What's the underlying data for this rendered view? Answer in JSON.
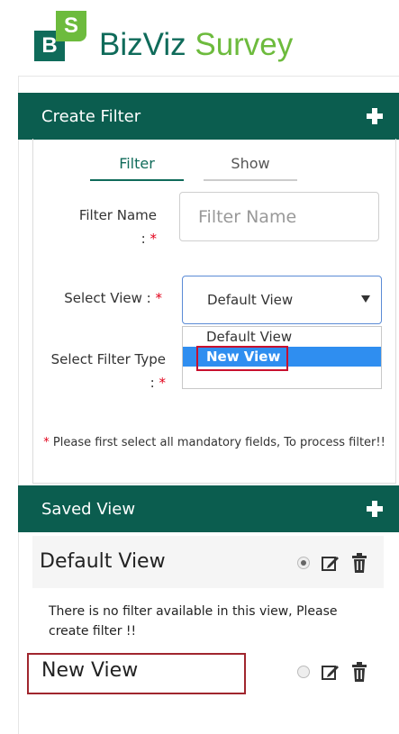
{
  "brand": {
    "logo_b": "B",
    "logo_s": "S",
    "word1": "BizViz",
    "word2": "Survey"
  },
  "create_filter": {
    "title": "Create Filter",
    "tabs": [
      {
        "label": "Filter",
        "active": true
      },
      {
        "label": "Show",
        "active": false
      }
    ],
    "filter_name_label": "Filter Name",
    "filter_name_colon": ":",
    "filter_name_placeholder": "Filter Name",
    "select_view_label": "Select View :",
    "select_view_value": "Default View",
    "select_view_options": [
      "Default View",
      "New View"
    ],
    "select_filter_type_label": "Select Filter Type",
    "select_filter_type_colon": ":",
    "required_mark": "*",
    "hint_text": "Please first select all mandatory fields, To process filter!!"
  },
  "saved_view": {
    "title": "Saved View",
    "views": [
      {
        "name": "Default View",
        "selected": true
      },
      {
        "name": "New View",
        "selected": false
      }
    ],
    "empty_message": "There is no filter available in this view, Please create filter !!"
  },
  "colors": {
    "brand_dark": "#0b5d4f",
    "brand_green": "#6dbb3d",
    "highlight": "#2f8ef0",
    "required": "#e2001a"
  }
}
